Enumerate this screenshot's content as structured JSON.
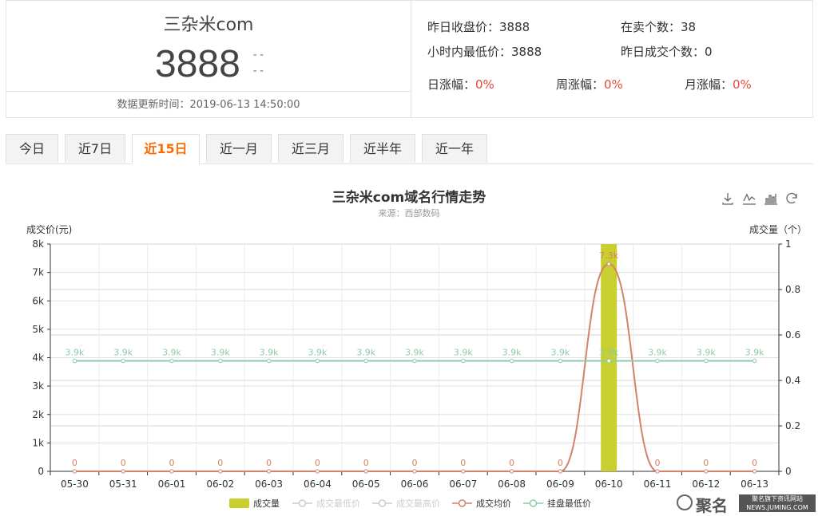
{
  "summary": {
    "domain_title": "三杂米com",
    "price": "3888",
    "price_dash_top": "--",
    "price_dash_bottom": "--",
    "update_time": "数据更新时间：2019-06-13 14:50:00",
    "yesterday_close_label": "昨日收盘价：",
    "yesterday_close_value": "3888",
    "on_sale_label": "在卖个数：",
    "on_sale_value": "38",
    "hour_low_label": "小时内最低价：",
    "hour_low_value": "3888",
    "yesterday_deals_label": "昨日成交个数：",
    "yesterday_deals_value": "0",
    "day_change_label": "日涨幅：",
    "day_change_value": "0%",
    "week_change_label": "周涨幅：",
    "week_change_value": "0%",
    "month_change_label": "月涨幅：",
    "month_change_value": "0%"
  },
  "tabs": [
    {
      "label": "今日",
      "active": false
    },
    {
      "label": "近7日",
      "active": false
    },
    {
      "label": "近15日",
      "active": true
    },
    {
      "label": "近一月",
      "active": false
    },
    {
      "label": "近三月",
      "active": false
    },
    {
      "label": "近半年",
      "active": false
    },
    {
      "label": "近一年",
      "active": false
    }
  ],
  "toolbox": [
    "download-icon",
    "line-chart-icon",
    "bar-chart-icon",
    "refresh-icon"
  ],
  "watermark": {
    "brand": "聚名",
    "line1": "聚名旗下资讯网站",
    "line2": "NEWS.JUMING.COM"
  },
  "colors": {
    "active_tab": "#ff6a00",
    "change_red": "#e8463c",
    "bar": "#c8cf2f",
    "avg_line": "#d4826a",
    "min_list_line": "#8fcaa9",
    "inactive_legend": "#cccccc"
  },
  "chart_data": {
    "type": "line",
    "title": "三杂米com域名行情走势",
    "subtitle": "来源：西部数码",
    "y_left_label": "成交价(元)",
    "y_right_label": "成交量（个）",
    "y_left_ticks": [
      "0",
      "1k",
      "2k",
      "3k",
      "4k",
      "5k",
      "6k",
      "7k",
      "8k"
    ],
    "y_left_range": [
      0,
      8000
    ],
    "y_right_ticks": [
      "0",
      "0.2",
      "0.4",
      "0.6",
      "0.8",
      "1"
    ],
    "y_right_range": [
      0,
      1
    ],
    "categories": [
      "05-30",
      "05-31",
      "06-01",
      "06-02",
      "06-03",
      "06-04",
      "06-05",
      "06-06",
      "06-07",
      "06-08",
      "06-09",
      "06-10",
      "06-11",
      "06-12",
      "06-13"
    ],
    "series": [
      {
        "name": "成交量",
        "kind": "bar",
        "axis": "right",
        "color": "#c8cf2f",
        "values": [
          0,
          0,
          0,
          0,
          0,
          0,
          0,
          0,
          0,
          0,
          0,
          1,
          0,
          0,
          0
        ]
      },
      {
        "name": "成交最低价",
        "kind": "line",
        "axis": "left",
        "color": "#cccccc",
        "hidden": true,
        "values": []
      },
      {
        "name": "成交最高价",
        "kind": "line",
        "axis": "left",
        "color": "#cccccc",
        "hidden": true,
        "values": []
      },
      {
        "name": "成交均价",
        "kind": "line",
        "axis": "left",
        "color": "#d4826a",
        "smooth": true,
        "values": [
          0,
          0,
          0,
          0,
          0,
          0,
          0,
          0,
          0,
          0,
          0,
          7300,
          0,
          0,
          0
        ],
        "labels": [
          "0",
          "0",
          "0",
          "0",
          "0",
          "0",
          "0",
          "0",
          "0",
          "0",
          "0",
          "7.3k",
          "0",
          "0",
          "0"
        ]
      },
      {
        "name": "挂盘最低价",
        "kind": "line",
        "axis": "left",
        "color": "#8fcaa9",
        "values": [
          3888,
          3888,
          3888,
          3888,
          3888,
          3888,
          3888,
          3888,
          3888,
          3888,
          3888,
          3888,
          3888,
          3888,
          3888
        ],
        "labels": [
          "3.9k",
          "3.9k",
          "3.9k",
          "3.9k",
          "3.9k",
          "3.9k",
          "3.9k",
          "3.9k",
          "3.9k",
          "3.9k",
          "3.9k",
          "3.9k",
          "3.9k",
          "3.9k",
          "3.9k"
        ]
      }
    ],
    "grid": true,
    "legend_position": "bottom"
  }
}
